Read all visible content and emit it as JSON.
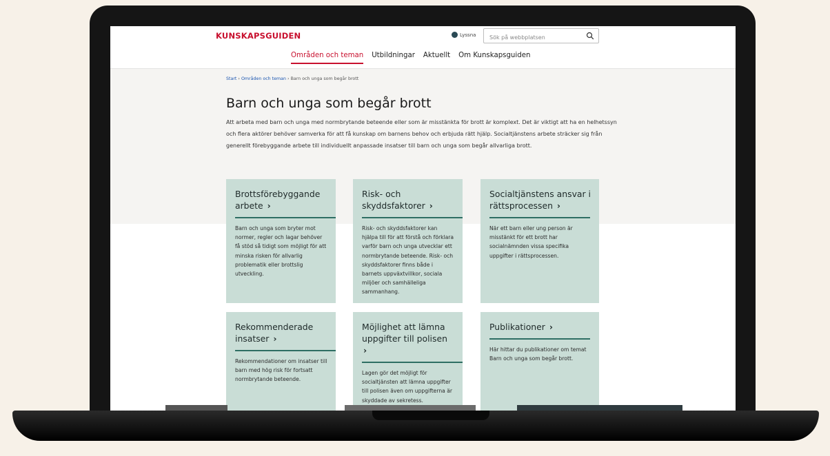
{
  "header": {
    "logo": "KUNSKAPSGUIDEN",
    "listen_label": "Lyssna",
    "search_placeholder": "Sök på webbplatsen",
    "nav": [
      {
        "label": "Områden och teman",
        "active": true
      },
      {
        "label": "Utbildningar",
        "active": false
      },
      {
        "label": "Aktuellt",
        "active": false
      },
      {
        "label": "Om Kunskapsguiden",
        "active": false
      }
    ]
  },
  "breadcrumb": {
    "start": "Start",
    "sep": "›",
    "section": "Områden och teman",
    "current": "Barn och unga som begår brott"
  },
  "page": {
    "title": "Barn och unga som begår brott",
    "intro": "Att arbeta med barn och unga med normbrytande beteende eller som är misstänkta för brott är komplext. Det är viktigt att ha en helhetssyn och flera aktörer behöver samverka för att få kunskap om barnens behov och erbjuda rätt hjälp. Socialtjänstens arbete sträcker sig från generellt förebyggande arbete till individuellt anpassade insatser till barn och unga som begår allvarliga brott."
  },
  "cards": [
    {
      "title": "Brottsförebyggande arbete",
      "chevron": "›",
      "text": "Barn och unga som bryter mot normer, regler och lagar behöver få stöd så tidigt som möjligt för att minska risken för allvarlig problematik eller brottslig utveckling."
    },
    {
      "title": "Risk- och skyddsfaktorer",
      "chevron": "›",
      "text": "Risk- och skyddsfaktorer kan hjälpa till för att förstå och förklara varför barn och unga utvecklar ett normbrytande beteende. Risk- och skyddsfaktorer finns både i barnets uppväxtvillkor, sociala miljöer och samhälleliga sammanhang."
    },
    {
      "title": "Socialtjänstens ansvar i rättsprocessen",
      "chevron": "›",
      "text": "När ett barn eller ung person är misstänkt för ett brott har socialnämnden vissa specifika uppgifter i rättsprocessen."
    },
    {
      "title": "Rekommenderade insatser",
      "chevron": "›",
      "text": "Rekommendationer om insatser till barn med hög risk för fortsatt normbrytande beteende."
    },
    {
      "title": "Möjlighet att lämna uppgifter till polisen",
      "chevron": "›",
      "text": "Lagen gör det möjligt för socialtjänsten att lämna uppgifter till polisen även om uppgifterna är skyddade av sekretess."
    },
    {
      "title": "Publikationer",
      "chevron": "›",
      "text": "Här hittar du publikationer om temat Barn och unga som begår brott."
    }
  ],
  "colors": {
    "brand_red": "#c8102e",
    "card_bg": "#c9ddd6",
    "card_rule": "#2e6e63",
    "page_bg": "#f7f1e8",
    "link_blue": "#1a55b0"
  },
  "icons": [
    "listen-icon",
    "search-icon",
    "chevron-right-icon"
  ]
}
